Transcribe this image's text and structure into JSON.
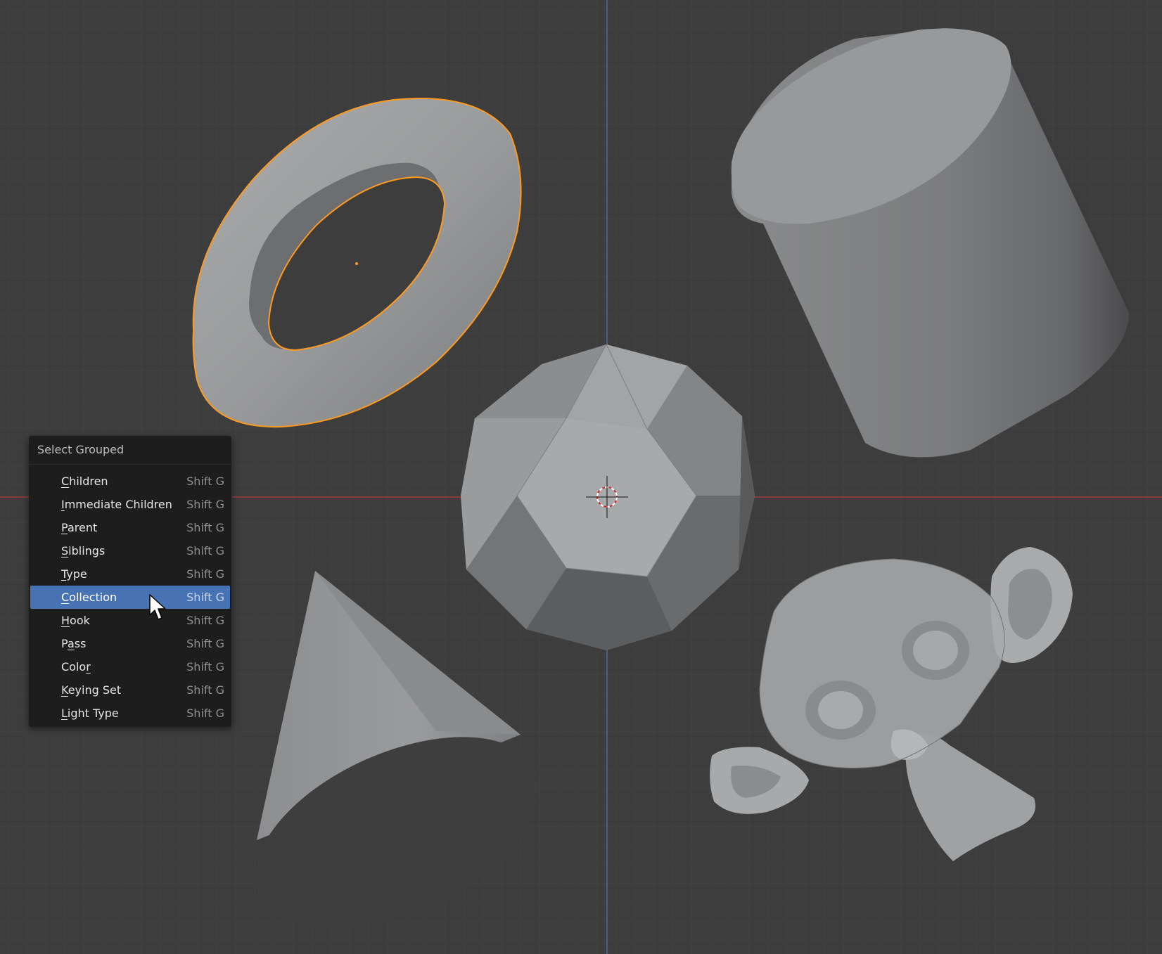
{
  "viewport": {
    "background": "#3d3d3d",
    "grid_color": "#474747",
    "x_axis_color": "#b34a4a",
    "y_axis_color": "#4f78a8",
    "selection_outline_color": "#ff9a1f"
  },
  "menu": {
    "title": "Select Grouped",
    "items": [
      {
        "pre": "",
        "ul": "C",
        "post": "hildren",
        "shortcut": "Shift G"
      },
      {
        "pre": "",
        "ul": "I",
        "post": "mmediate Children",
        "shortcut": "Shift G"
      },
      {
        "pre": "",
        "ul": "P",
        "post": "arent",
        "shortcut": "Shift G"
      },
      {
        "pre": "",
        "ul": "S",
        "post": "iblings",
        "shortcut": "Shift G"
      },
      {
        "pre": "",
        "ul": "T",
        "post": "ype",
        "shortcut": "Shift G"
      },
      {
        "pre": "",
        "ul": "C",
        "post": "ollection",
        "shortcut": "Shift G",
        "active": true
      },
      {
        "pre": "",
        "ul": "H",
        "post": "ook",
        "shortcut": "Shift G"
      },
      {
        "pre": "P",
        "ul": "a",
        "post": "ss",
        "shortcut": "Shift G"
      },
      {
        "pre": "Colo",
        "ul": "r",
        "post": "",
        "shortcut": "Shift G"
      },
      {
        "pre": "",
        "ul": "K",
        "post": "eying Set",
        "shortcut": "Shift G"
      },
      {
        "pre": "",
        "ul": "L",
        "post": "ight Type",
        "shortcut": "Shift G"
      }
    ]
  },
  "objects": {
    "torus": {
      "selected": true
    },
    "cylinder": {
      "selected": false
    },
    "icosphere": {
      "selected": false
    },
    "cone": {
      "selected": false
    },
    "monkey": {
      "selected": false
    }
  }
}
